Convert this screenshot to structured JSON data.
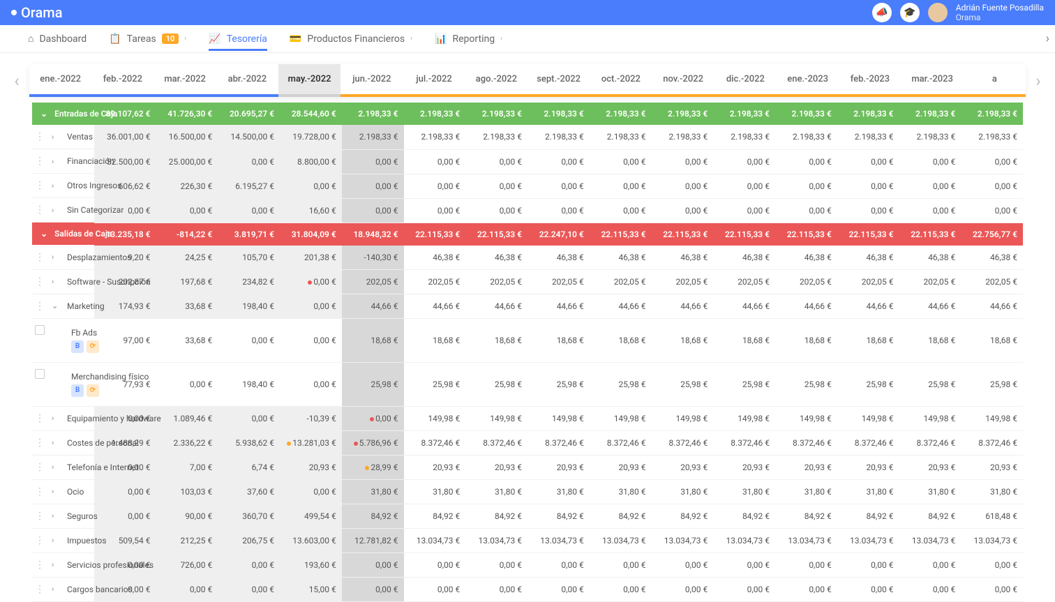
{
  "header": {
    "logo": "Orama",
    "user_name": "Adrián Fuente Posadilla",
    "user_org": "Orama"
  },
  "nav": {
    "items": [
      {
        "label": "Dashboard",
        "icon": "home"
      },
      {
        "label": "Tareas",
        "icon": "clipboard",
        "badge": "10"
      },
      {
        "label": "Tesorería",
        "icon": "chart",
        "active": true
      },
      {
        "label": "Productos Financieros",
        "icon": "card"
      },
      {
        "label": "Reporting",
        "icon": "bars"
      }
    ]
  },
  "timeline": {
    "months": [
      "ene.-2022",
      "feb.-2022",
      "mar.-2022",
      "abr.-2022",
      "may.-2022",
      "jun.-2022",
      "jul.-2022",
      "ago.-2022",
      "sept.-2022",
      "oct.-2022",
      "nov.-2022",
      "dic.-2022",
      "ene.-2023",
      "feb.-2023",
      "mar.-2023",
      "a"
    ],
    "current": 4,
    "past_until": 4
  },
  "sections": [
    {
      "type": "header",
      "color": "green",
      "label": "Entradas de Caja",
      "values": [
        "89.107,62 €",
        "41.726,30 €",
        "20.695,27 €",
        "28.544,60 €",
        "2.198,33 €",
        "2.198,33 €",
        "2.198,33 €",
        "2.198,33 €",
        "2.198,33 €",
        "2.198,33 €",
        "2.198,33 €",
        "2.198,33 €",
        "2.198,33 €",
        "2.198,33 €",
        "2.198,33 €"
      ]
    },
    {
      "type": "row",
      "label": "Ventas",
      "expand": "right",
      "values": [
        "36.001,00 €",
        "16.500,00 €",
        "14.500,00 €",
        "19.728,00 €",
        "2.198,33 €",
        "2.198,33 €",
        "2.198,33 €",
        "2.198,33 €",
        "2.198,33 €",
        "2.198,33 €",
        "2.198,33 €",
        "2.198,33 €",
        "2.198,33 €",
        "2.198,33 €",
        "2.198,33 €"
      ]
    },
    {
      "type": "row",
      "label": "Financiación",
      "expand": "right",
      "values": [
        "52.500,00 €",
        "25.000,00 €",
        "0,00 €",
        "8.800,00 €",
        "0,00 €",
        "0,00 €",
        "0,00 €",
        "0,00 €",
        "0,00 €",
        "0,00 €",
        "0,00 €",
        "0,00 €",
        "0,00 €",
        "0,00 €",
        "0,00 €"
      ]
    },
    {
      "type": "row",
      "label": "Otros Ingresos",
      "expand": "right",
      "values": [
        "606,62 €",
        "226,30 €",
        "6.195,27 €",
        "0,00 €",
        "0,00 €",
        "0,00 €",
        "0,00 €",
        "0,00 €",
        "0,00 €",
        "0,00 €",
        "0,00 €",
        "0,00 €",
        "0,00 €",
        "0,00 €",
        "0,00 €"
      ]
    },
    {
      "type": "row",
      "label": "Sin Categorizar",
      "expand": "right",
      "values": [
        "0,00 €",
        "0,00 €",
        "0,00 €",
        "16,60 €",
        "0,00 €",
        "0,00 €",
        "0,00 €",
        "0,00 €",
        "0,00 €",
        "0,00 €",
        "0,00 €",
        "0,00 €",
        "0,00 €",
        "0,00 €",
        "0,00 €"
      ]
    },
    {
      "type": "header",
      "color": "red",
      "label": "Salidas de Caja",
      "values": [
        "13.235,18 €",
        "-814,22 €",
        "3.819,71 €",
        "31.804,09 €",
        "18.948,32 €",
        "22.115,33 €",
        "22.115,33 €",
        "22.247,10 €",
        "22.115,33 €",
        "22.115,33 €",
        "22.115,33 €",
        "22.115,33 €",
        "22.115,33 €",
        "22.115,33 €",
        "22.756,77 €"
      ]
    },
    {
      "type": "row",
      "label": "Desplazamientos",
      "expand": "right",
      "values": [
        "9,20 €",
        "24,25 €",
        "105,70 €",
        "201,38 €",
        "-140,30 €",
        "46,38 €",
        "46,38 €",
        "46,38 €",
        "46,38 €",
        "46,38 €",
        "46,38 €",
        "46,38 €",
        "46,38 €",
        "46,38 €",
        "46,38 €"
      ]
    },
    {
      "type": "row",
      "label": "Software - Suscripción",
      "expand": "right",
      "values": [
        "202,87 €",
        "197,68 €",
        "234,82 €",
        "0,00 €",
        "202,05 €",
        "202,05 €",
        "202,05 €",
        "202,05 €",
        "202,05 €",
        "202,05 €",
        "202,05 €",
        "202,05 €",
        "202,05 €",
        "202,05 €",
        "202,05 €"
      ],
      "dots": {
        "3": "red"
      }
    },
    {
      "type": "row",
      "label": "Marketing",
      "expand": "down",
      "values": [
        "174,93 €",
        "33,68 €",
        "198,40 €",
        "0,00 €",
        "44,66 €",
        "44,66 €",
        "44,66 €",
        "44,66 €",
        "44,66 €",
        "44,66 €",
        "44,66 €",
        "44,66 €",
        "44,66 €",
        "44,66 €",
        "44,66 €"
      ]
    },
    {
      "type": "sub",
      "label": "Fb Ads",
      "values": [
        "97,00 €",
        "33,68 €",
        "0,00 €",
        "0,00 €",
        "18,68 €",
        "18,68 €",
        "18,68 €",
        "18,68 €",
        "18,68 €",
        "18,68 €",
        "18,68 €",
        "18,68 €",
        "18,68 €",
        "18,68 €",
        "18,68 €"
      ]
    },
    {
      "type": "sub",
      "label": "Merchandising físico",
      "values": [
        "77,93 €",
        "0,00 €",
        "198,40 €",
        "0,00 €",
        "25,98 €",
        "25,98 €",
        "25,98 €",
        "25,98 €",
        "25,98 €",
        "25,98 €",
        "25,98 €",
        "25,98 €",
        "25,98 €",
        "25,98 €",
        "25,98 €"
      ]
    },
    {
      "type": "row",
      "label": "Equipamiento y hardware",
      "expand": "right",
      "values": [
        "0,00 €",
        "1.089,46 €",
        "0,00 €",
        "-10,39 €",
        "0,00 €",
        "149,98 €",
        "149,98 €",
        "149,98 €",
        "149,98 €",
        "149,98 €",
        "149,98 €",
        "149,98 €",
        "149,98 €",
        "149,98 €",
        "149,98 €"
      ],
      "dots": {
        "4": "red"
      }
    },
    {
      "type": "row",
      "label": "Costes de personal",
      "expand": "right",
      "values": [
        "1.488,29 €",
        "2.336,22 €",
        "5.938,62 €",
        "13.281,03 €",
        "5.786,96 €",
        "8.372,46 €",
        "8.372,46 €",
        "8.372,46 €",
        "8.372,46 €",
        "8.372,46 €",
        "8.372,46 €",
        "8.372,46 €",
        "8.372,46 €",
        "8.372,46 €",
        "8.372,46 €"
      ],
      "dots": {
        "3": "orange",
        "4": "red"
      }
    },
    {
      "type": "row",
      "label": "Telefonía e Internet",
      "expand": "right",
      "values": [
        "0,00 €",
        "7,00 €",
        "6,74 €",
        "20,93 €",
        "28,99 €",
        "20,93 €",
        "20,93 €",
        "20,93 €",
        "20,93 €",
        "20,93 €",
        "20,93 €",
        "20,93 €",
        "20,93 €",
        "20,93 €",
        "20,93 €"
      ],
      "dots": {
        "4": "orange"
      }
    },
    {
      "type": "row",
      "label": "Ocio",
      "expand": "right",
      "values": [
        "0,00 €",
        "103,03 €",
        "37,60 €",
        "0,00 €",
        "31,80 €",
        "31,80 €",
        "31,80 €",
        "31,80 €",
        "31,80 €",
        "31,80 €",
        "31,80 €",
        "31,80 €",
        "31,80 €",
        "31,80 €",
        "31,80 €"
      ]
    },
    {
      "type": "row",
      "label": "Seguros",
      "expand": "right",
      "values": [
        "0,00 €",
        "90,00 €",
        "360,70 €",
        "499,54 €",
        "84,92 €",
        "84,92 €",
        "84,92 €",
        "84,92 €",
        "84,92 €",
        "84,92 €",
        "84,92 €",
        "84,92 €",
        "84,92 €",
        "84,92 €",
        "618,48 €"
      ]
    },
    {
      "type": "row",
      "label": "Impuestos",
      "expand": "right",
      "values": [
        "509,54 €",
        "212,25 €",
        "206,75 €",
        "13.603,00 €",
        "12.781,82 €",
        "13.034,73 €",
        "13.034,73 €",
        "13.034,73 €",
        "13.034,73 €",
        "13.034,73 €",
        "13.034,73 €",
        "13.034,73 €",
        "13.034,73 €",
        "13.034,73 €",
        "13.034,73 €"
      ]
    },
    {
      "type": "row",
      "label": "Servicios profesionales",
      "expand": "right",
      "values": [
        "0,00 €",
        "726,00 €",
        "0,00 €",
        "193,60 €",
        "0,00 €",
        "0,00 €",
        "0,00 €",
        "0,00 €",
        "0,00 €",
        "0,00 €",
        "0,00 €",
        "0,00 €",
        "0,00 €",
        "0,00 €",
        "0,00 €"
      ]
    },
    {
      "type": "row",
      "label": "Cargos bancarios",
      "expand": "right",
      "values": [
        "0,00 €",
        "0,00 €",
        "0,00 €",
        "15,00 €",
        "0,00 €",
        "0,00 €",
        "0,00 €",
        "0,00 €",
        "0,00 €",
        "0,00 €",
        "0,00 €",
        "0,00 €",
        "0,00 €",
        "0,00 €",
        "0,00 €"
      ]
    }
  ]
}
